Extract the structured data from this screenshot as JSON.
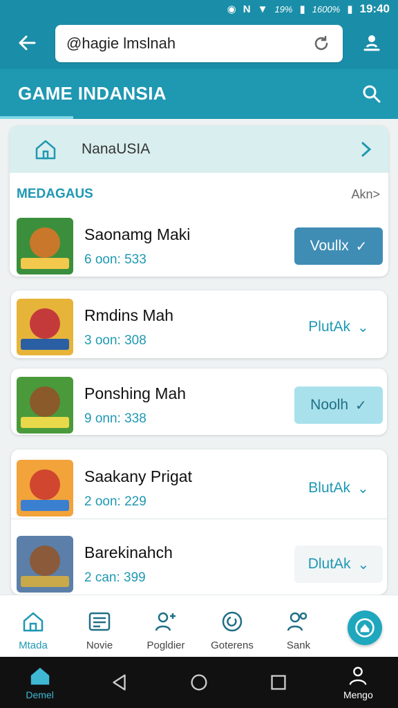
{
  "status": {
    "carrier_icon": "N",
    "battery": "19%",
    "signal_text": "1600%",
    "time": "19:40"
  },
  "address_bar": {
    "value": "@hagie lmslnah"
  },
  "header": {
    "title": "GAME INDANSIA"
  },
  "breadcrumb": {
    "label": "NanaUSIA"
  },
  "section": {
    "title": "MEDAGAUS",
    "more": "Akn>"
  },
  "games": [
    {
      "name": "Saonamg Maki",
      "meta": "6 oon: 533",
      "action": "Voullx",
      "style": "solid",
      "icon_colors": [
        "#3b8f3c",
        "#c9772a",
        "#f2c94c"
      ]
    },
    {
      "name": "Rmdins Mah",
      "meta": "3 oon: 308",
      "action": "PlutAk",
      "style": "plain",
      "icon_colors": [
        "#e7b43a",
        "#c43a3a",
        "#2b5fa3"
      ]
    },
    {
      "name": "Ponshing Mah",
      "meta": "9 onn: 338",
      "action": "Noolh",
      "style": "light",
      "icon_colors": [
        "#4a9a3c",
        "#8a5a2a",
        "#e9d84a"
      ]
    },
    {
      "name": "Saakany Prigat",
      "meta": "2 oon: 229",
      "action": "BlutAk",
      "style": "plain",
      "icon_colors": [
        "#f2a33a",
        "#d0462f",
        "#3b7fd0"
      ]
    },
    {
      "name": "Barekinahch",
      "meta": "2 can: 399",
      "action": "DlutAk",
      "style": "faint",
      "icon_colors": [
        "#5b7fa8",
        "#8b5a3a",
        "#c9a94a"
      ]
    }
  ],
  "bottom_nav": [
    {
      "label": "Mtada",
      "icon": "home-icon",
      "active": true
    },
    {
      "label": "Novie",
      "icon": "list-icon",
      "active": false
    },
    {
      "label": "Pogldier",
      "icon": "person-add-icon",
      "active": false
    },
    {
      "label": "Goterens",
      "icon": "circle-arrow-icon",
      "active": false
    },
    {
      "label": "Sank",
      "icon": "people-icon",
      "active": false
    }
  ],
  "system_nav": {
    "home_label": "Demel",
    "profile_label": "Mengo"
  },
  "colors": {
    "primary": "#1a8ea8",
    "accent": "#1f98b2",
    "button": "#3f8db5"
  }
}
